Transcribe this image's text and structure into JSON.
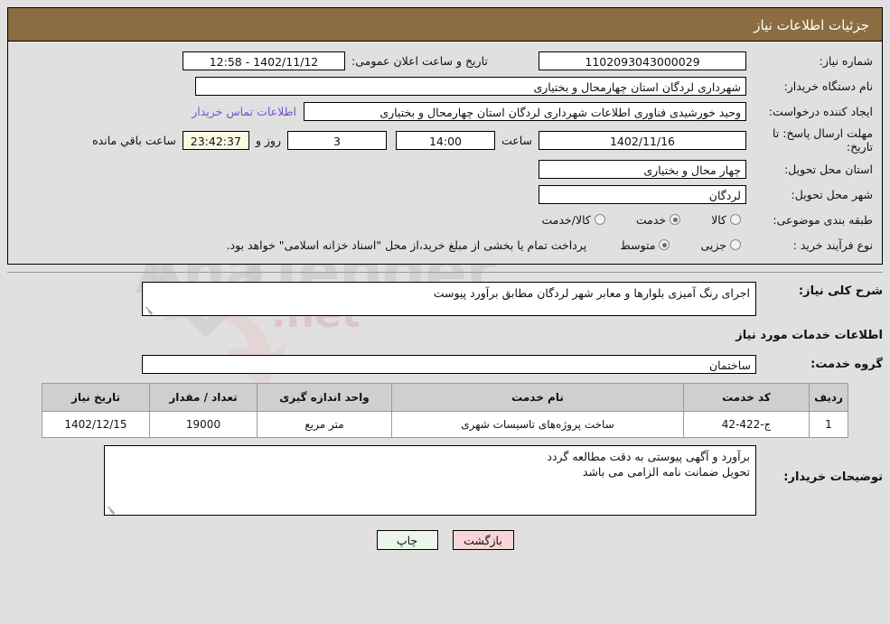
{
  "header": {
    "title": "جزئیات اطلاعات نیاز"
  },
  "form": {
    "need_number_label": "شماره نیاز:",
    "need_number_value": "1102093043000029",
    "announce_label": "تاریخ و ساعت اعلان عمومی:",
    "announce_value": "1402/11/12 - 12:58",
    "buyer_org_label": "نام دستگاه خریدار:",
    "buyer_org_value": "شهرداری لردگان استان چهارمحال و بختیاری",
    "creator_label": "ایجاد کننده درخواست:",
    "creator_value": "وحید خورشیدی فناوری اطلاعات شهرداری لردگان استان چهارمحال و بختیاری",
    "contact_link": "اطلاعات تماس خریدار",
    "deadline_label": "مهلت ارسال پاسخ: تا تاریخ:",
    "deadline_date": "1402/11/16",
    "hour_label": "ساعت",
    "hour_value": "14:00",
    "days_value": "3",
    "days_label": "روز و",
    "timer_value": "23:42:37",
    "timer_label": "ساعت باقي مانده",
    "province_label": "استان محل تحویل:",
    "province_value": "چهار محال و بختیاری",
    "city_label": "شهر محل تحویل:",
    "city_value": "لردگان",
    "category_label": "طبقه بندی موضوعی:",
    "category_options": [
      {
        "label": "کالا",
        "selected": false
      },
      {
        "label": "خدمت",
        "selected": true
      },
      {
        "label": "کالا/خدمت",
        "selected": false
      }
    ],
    "process_label": "نوع فرآیند خرید :",
    "process_options": [
      {
        "label": "جزیی",
        "selected": false
      },
      {
        "label": "متوسط",
        "selected": true
      }
    ],
    "process_note": "پرداخت تمام یا بخشی از مبلغ خرید،از محل \"اسناد خزانه اسلامی\" خواهد بود."
  },
  "summary": {
    "label": "شرح کلی نیاز:",
    "value": "اجرای رنگ آمیزی بلوارها و معابر شهر لردگان مطابق برآورد پیوست"
  },
  "services": {
    "section_title": "اطلاعات خدمات مورد نیاز",
    "group_label": "گروه خدمت:",
    "group_value": "ساختمان",
    "columns": [
      "ردیف",
      "کد خدمت",
      "نام خدمت",
      "واحد اندازه گیری",
      "تعداد / مقدار",
      "تاریخ نیاز"
    ],
    "rows": [
      {
        "index": "1",
        "code": "ج-422-42",
        "name": "ساخت پروژه‌های تاسیسات شهری",
        "unit": "متر مربع",
        "qty": "19000",
        "date": "1402/12/15"
      }
    ]
  },
  "notes": {
    "label": "توضیحات خریدار:",
    "line1": "برآورد و آگهی پیوستی به دقت مطالعه گردد",
    "line2": "تحویل ضمانت نامه الزامی می باشد"
  },
  "buttons": {
    "print": "چاپ",
    "back": "بازگشت"
  },
  "watermark": {
    "text": "AnaTender",
    "text2": ".net"
  },
  "colors": {
    "header_bg": "#8b6d41",
    "link": "#7b4fd1",
    "timer_bg": "#fbf9e2",
    "print_btn": "#eaf6ea",
    "back_btn": "#f8d5d8",
    "table_header": "#cfcfcf"
  }
}
